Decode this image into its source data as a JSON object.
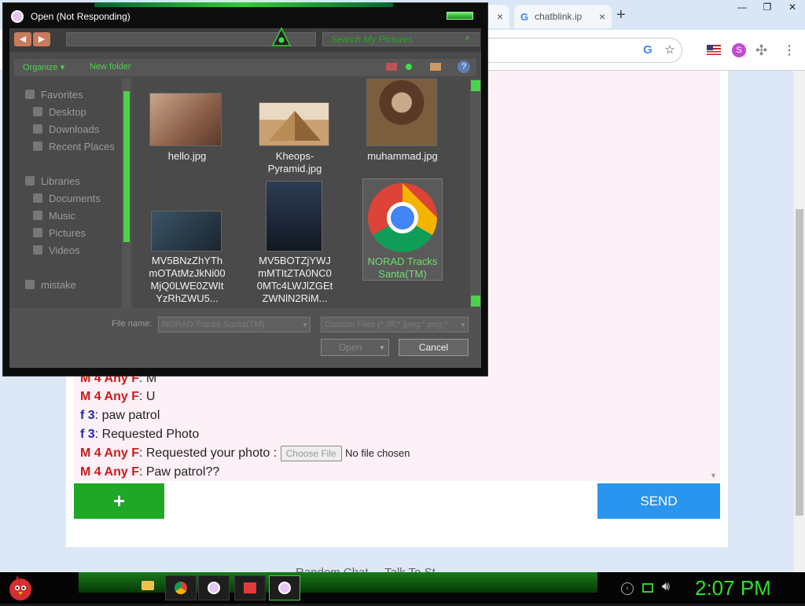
{
  "browser": {
    "tabs": [
      {
        "label": "",
        "close": "×"
      },
      {
        "label": "chatblink.ip",
        "close": "×"
      }
    ],
    "new_tab": "+",
    "window_controls": [
      "—",
      "❐",
      "✕"
    ],
    "google_icon": "G",
    "star_icon": "☆",
    "extension_icons": [
      "flag-us-icon",
      "s-extension-icon",
      "puzzle-icon"
    ],
    "menu_icon": "⋮"
  },
  "chat": {
    "messages": [
      {
        "sender": "M 4 Any F",
        "sender_type": "m",
        "text": ": M"
      },
      {
        "sender": "M 4 Any F",
        "sender_type": "m",
        "text": ": U"
      },
      {
        "sender": "f 3",
        "sender_type": "f",
        "text": ": paw patrol"
      },
      {
        "sender": "f 3",
        "sender_type": "f",
        "text": ": Requested Photo"
      },
      {
        "sender": "M 4 Any F",
        "sender_type": "m",
        "text": ": Requested your photo : "
      },
      {
        "sender": "M 4 Any F",
        "sender_type": "m",
        "text": ": Paw patrol??"
      }
    ],
    "choose_file_label": "Choose File",
    "no_file_label": "No file chosen",
    "plus_label": "+",
    "send_label": "SEND",
    "footer_text": "Random Chat ... Talk To St..."
  },
  "dialog": {
    "title": "Open (Not Responding)",
    "search_placeholder": "Search My Pictures",
    "organize_label": "Organize ▾",
    "new_folder_label": "New folder",
    "help_label": "?",
    "nav": {
      "favorites": "Favorites",
      "desktop": "Desktop",
      "downloads": "Downloads",
      "recent_places": "Recent Places",
      "libraries": "Libraries",
      "documents": "Documents",
      "music": "Music",
      "pictures": "Pictures",
      "videos": "Videos",
      "mistake": "mistake"
    },
    "files": [
      {
        "name": "hello.jpg",
        "thumb_color": "#b98a6d"
      },
      {
        "name": "Kheops-Pyramid.jpg",
        "thumb_color": "#d2b48c"
      },
      {
        "name": "muhammad.jpg",
        "thumb_color": "#8b5a3c"
      },
      {
        "name": "MV5BNzZhYThmOTAtMzJkNi00MjQ0LWE0ZWItYzRhZWU5...",
        "thumb_color": "#2e3b44"
      },
      {
        "name": "MV5BOTZjYWJmMTItZTA0NC00MTc4LWJlZGEtZWNlN2RiM...",
        "thumb_color": "#1f2a3a"
      },
      {
        "name": "NORAD Tracks Santa(TM)",
        "thumb_color": "chrome"
      }
    ],
    "file_name_label": "File name:",
    "file_name_value": "NORAD Tracks Santa(TM)",
    "filter_value": "Custom Files (*.jfif;*.jpeg;*.png;*",
    "open_label": "Open",
    "cancel_label": "Cancel"
  },
  "taskbar": {
    "clock": "2:07 PM"
  }
}
